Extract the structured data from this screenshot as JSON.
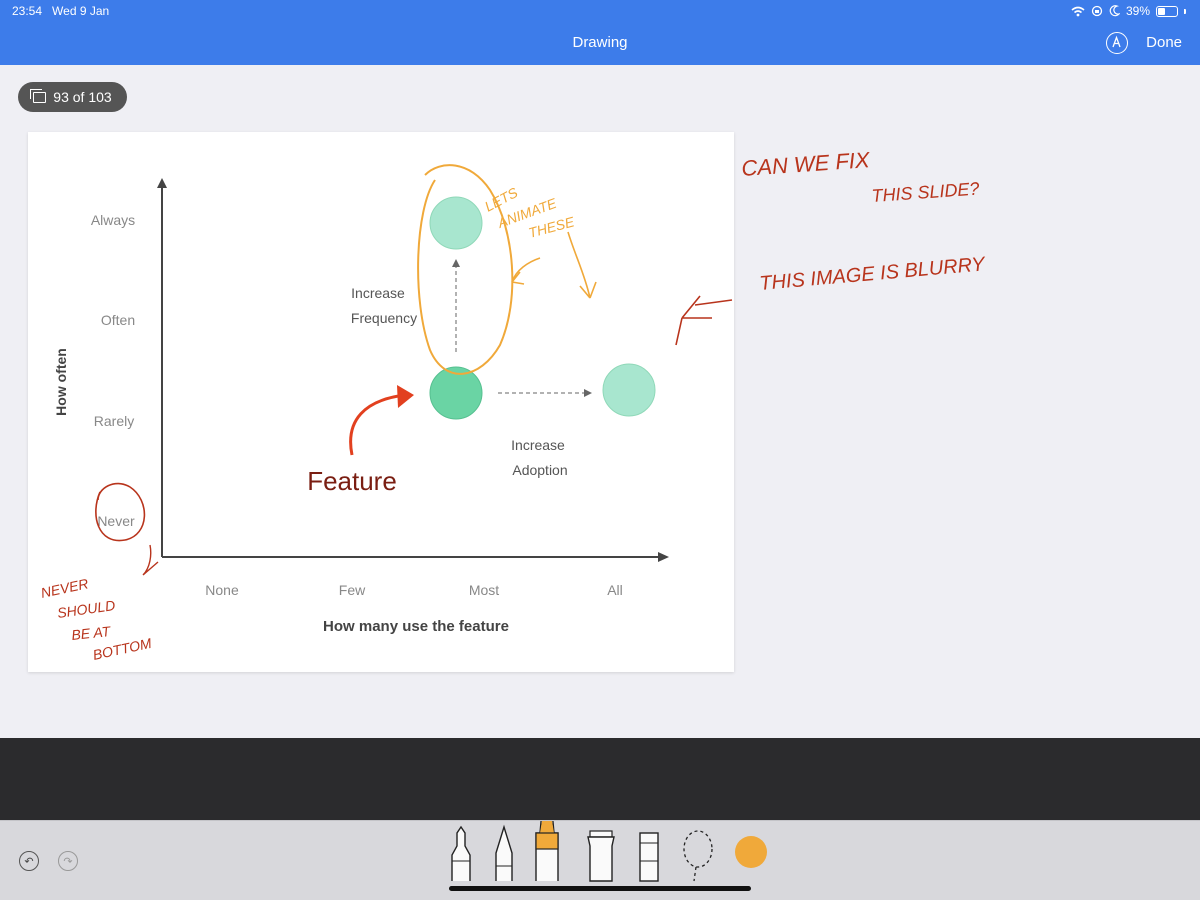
{
  "status": {
    "time": "23:54",
    "date": "Wed 9 Jan",
    "battery": "39%",
    "battery_level": 0.39
  },
  "nav": {
    "title": "Drawing",
    "done_label": "Done"
  },
  "page_counter": {
    "label": "93 of 103"
  },
  "slide": {
    "y_axis_title": "How often",
    "y_ticks": [
      "Always",
      "Often",
      "Rarely",
      "Never"
    ],
    "x_axis_title": "How many use the feature",
    "x_ticks": [
      "None",
      "Few",
      "Most",
      "All"
    ],
    "label_frequency": [
      "Increase",
      "Frequency"
    ],
    "label_adoption": [
      "Increase",
      "Adoption"
    ]
  },
  "annotations": {
    "feature": "Feature",
    "animate": [
      "LETS",
      "ANIMATE",
      "THESE"
    ],
    "fix_slide": [
      "CAN WE FIX",
      "THIS SLIDE?"
    ],
    "blurry": "THIS IMAGE IS BLURRY",
    "never_note": [
      "NEVER",
      "SHOULD",
      "BE AT",
      "BOTTOM"
    ]
  },
  "colors": {
    "accent_blue": "#3d7cea",
    "ink_red": "#b8341c",
    "ink_orange": "#f0a93a",
    "circle_light": "#a8e6cf",
    "circle_dark": "#6ad4a4"
  },
  "tools": [
    "undo-icon",
    "redo-icon",
    "pen-tool-icon",
    "pencil-tool-icon",
    "marker-tool-icon",
    "eraser-tool-icon",
    "ruler-tool-icon",
    "lasso-tool-icon",
    "color-picker-icon"
  ]
}
